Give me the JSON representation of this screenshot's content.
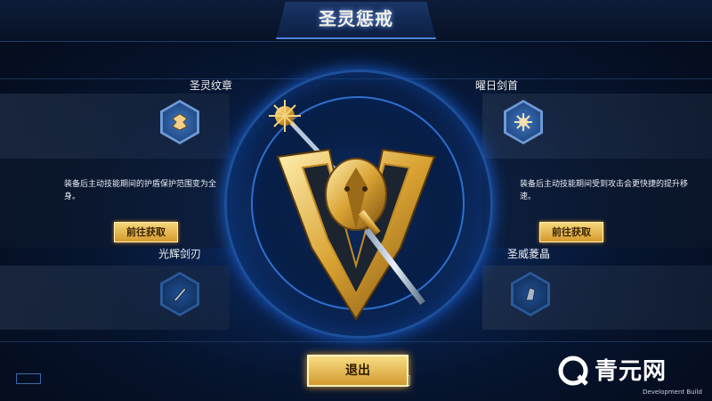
{
  "title": "圣灵惩戒",
  "slots": [
    {
      "label": "圣灵纹章",
      "icon": "wing-emblem-icon",
      "description": "装备后主动技能期间的护盾保护范围变为全身。",
      "action": "前往获取"
    },
    {
      "label": "曜日剑首",
      "icon": "sun-pommel-icon",
      "description": "装备后主动技能期间受到攻击会更快捷的提升移速。",
      "action": "前往获取"
    },
    {
      "label": "光辉剑刃",
      "icon": "blade-shard-icon"
    },
    {
      "label": "圣威菱晶",
      "icon": "crystal-icon"
    }
  ],
  "exit_label": "退出",
  "watermark": "青元网",
  "build_label": "Development Build",
  "colors": {
    "accent_gold": "#f0c25a",
    "panel_blue": "#1a3566",
    "glow_blue": "#2e6fd0"
  }
}
